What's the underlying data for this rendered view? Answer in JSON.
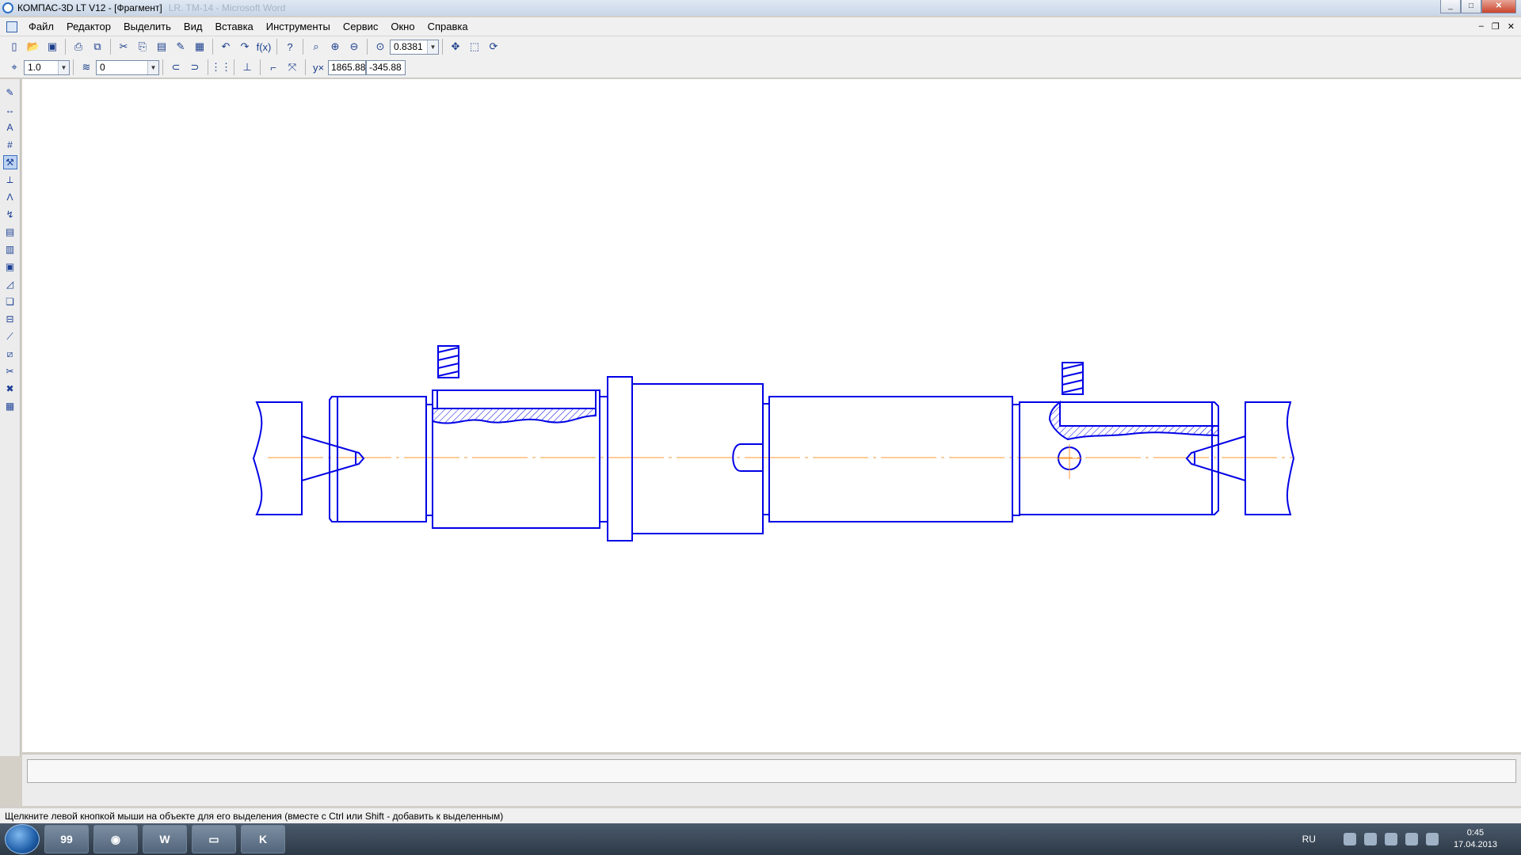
{
  "window": {
    "title": "КОМПАС-3D LT V12 - [Фрагмент]",
    "ghost_title": "LR. TM-14 - Microsoft Word"
  },
  "menu": [
    "Файл",
    "Редактор",
    "Выделить",
    "Вид",
    "Вставка",
    "Инструменты",
    "Сервис",
    "Окно",
    "Справка"
  ],
  "toolbar": {
    "zoom_value": "0.8381",
    "step_value": "1.0",
    "layer_value": "0",
    "coord_x": "1865.88",
    "coord_y": "-345.88"
  },
  "status": {
    "hint": "Щелкните левой кнопкой мыши на объекте для его выделения (вместе с Ctrl или Shift - добавить к выделенным)"
  },
  "taskbar": {
    "badge": "99",
    "lang": "RU",
    "time": "0:45",
    "date": "17.04.2013"
  },
  "colors": {
    "drawing_line": "#0000e6",
    "axis_line": "#ff9933",
    "canvas_bg": "#ffffff"
  }
}
